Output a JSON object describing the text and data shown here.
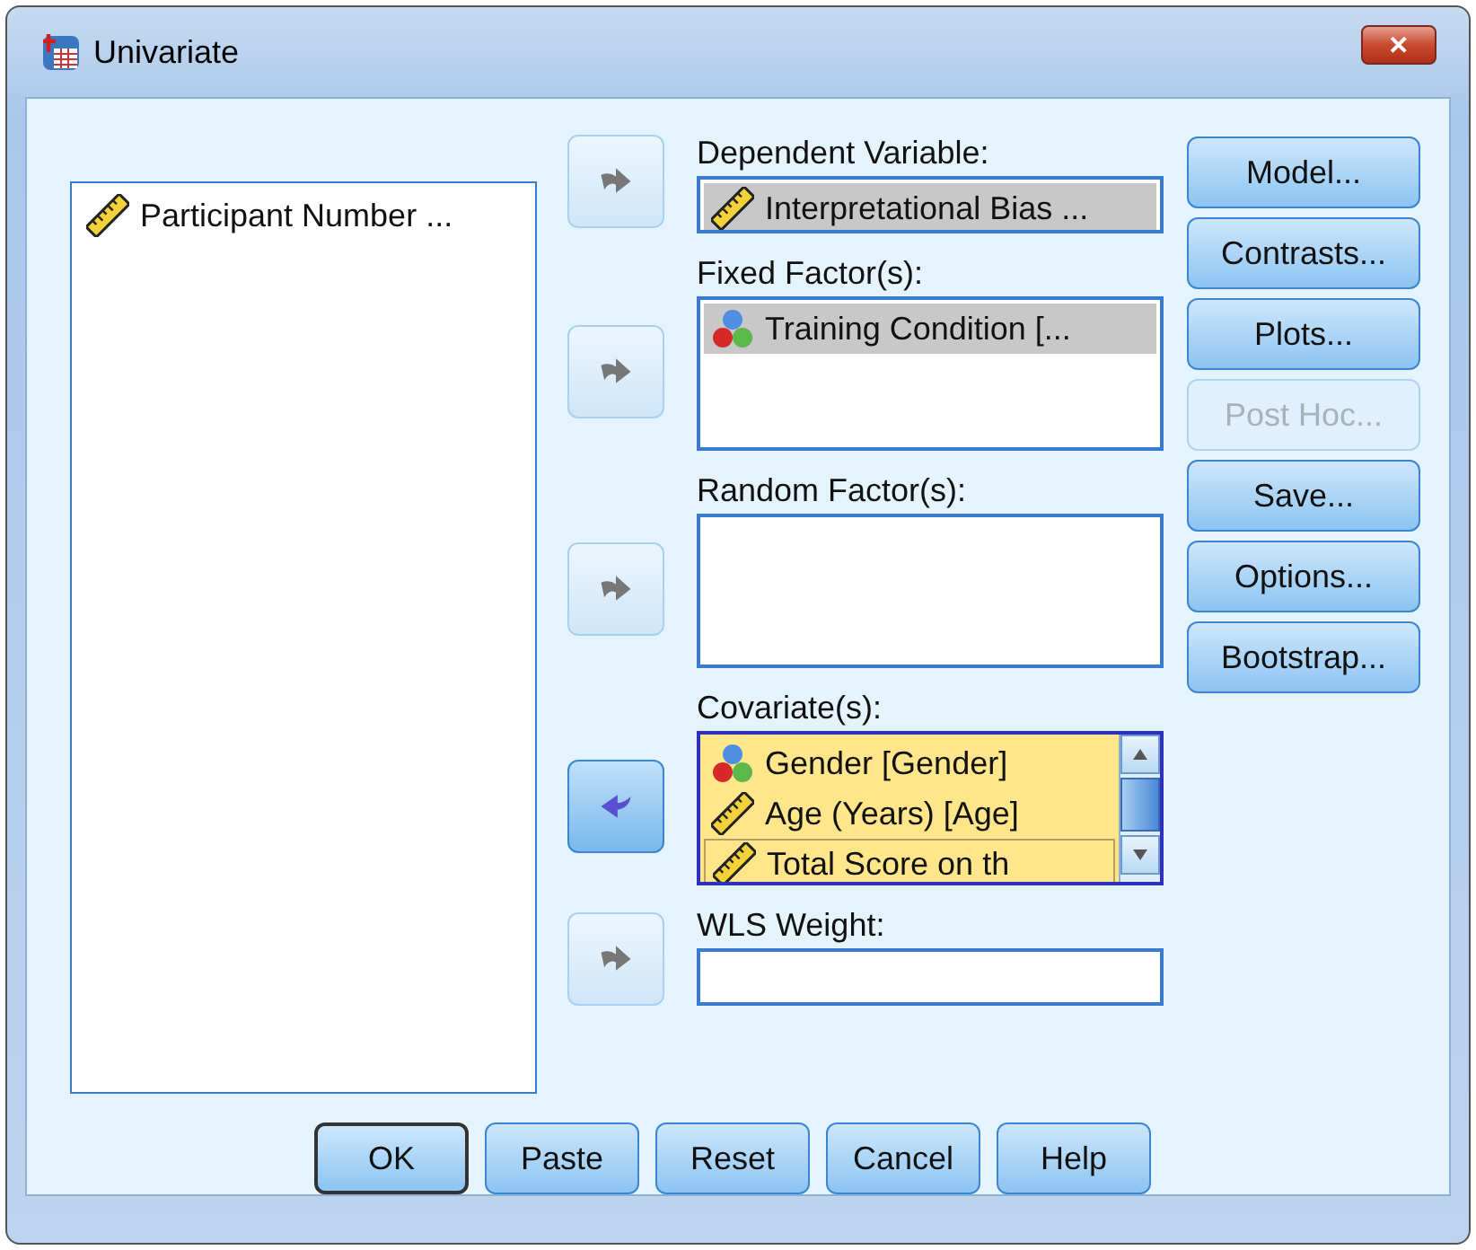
{
  "window": {
    "title": "Univariate",
    "close": "✕"
  },
  "source_list": {
    "items": [
      {
        "label": "Participant Number ...",
        "kind": "scale",
        "selected": false
      }
    ]
  },
  "targets": [
    {
      "label": "Dependent Variable:",
      "kind": "single",
      "arrow": {
        "kind": "move-in",
        "disabled": true
      },
      "items": [
        {
          "label": "Interpretational Bias ...",
          "kind": "scale",
          "selected": true,
          "focused": false
        }
      ]
    },
    {
      "label": "Fixed Factor(s):",
      "kind": "list",
      "arrow": {
        "kind": "move-in",
        "disabled": true
      },
      "items": [
        {
          "label": "Training Condition [...",
          "kind": "nominal",
          "selected": true,
          "focused": false
        }
      ]
    },
    {
      "label": "Random Factor(s):",
      "kind": "list",
      "arrow": {
        "kind": "move-in",
        "disabled": true
      }
    },
    {
      "label": "Covariate(s):",
      "kind": "scroll-list",
      "arrow": {
        "kind": "move-out",
        "disabled": false
      },
      "items": [
        {
          "label": "Gender [Gender]",
          "kind": "nominal",
          "focused": false
        },
        {
          "label": "Age (Years) [Age]",
          "kind": "scale",
          "focused": false
        },
        {
          "label": "Total Score on th",
          "kind": "scale",
          "focused": true
        }
      ]
    },
    {
      "label": "WLS Weight:",
      "kind": "single",
      "arrow": {
        "kind": "move-in",
        "disabled": true
      }
    }
  ],
  "side_buttons": [
    {
      "label": "Model...",
      "disabled": false
    },
    {
      "label": "Contrasts...",
      "disabled": false
    },
    {
      "label": "Plots...",
      "disabled": false
    },
    {
      "label": "Post Hoc...",
      "disabled": true
    },
    {
      "label": "Save...",
      "disabled": false
    },
    {
      "label": "Options...",
      "disabled": false
    },
    {
      "label": "Bootstrap...",
      "disabled": false
    }
  ],
  "buttons": [
    {
      "label": "OK",
      "default": true
    },
    {
      "label": "Paste",
      "default": false
    },
    {
      "label": "Reset",
      "default": false
    },
    {
      "label": "Cancel",
      "default": false
    },
    {
      "label": "Help",
      "default": false
    }
  ]
}
